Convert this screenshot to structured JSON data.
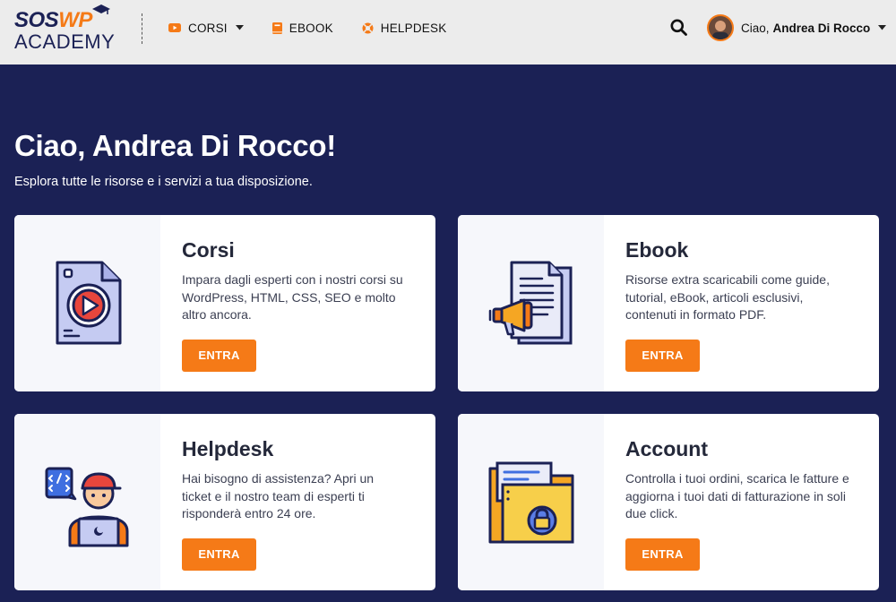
{
  "logo": {
    "line1_a": "SOS",
    "line1_b": "WP",
    "line2": "ACADEMY"
  },
  "nav": {
    "items": [
      {
        "label": "CORSI",
        "icon": "youtube-icon",
        "has_dropdown": true
      },
      {
        "label": "EBOOK",
        "icon": "book-icon",
        "has_dropdown": false
      },
      {
        "label": "HELPDESK",
        "icon": "lifebuoy-icon",
        "has_dropdown": false
      }
    ]
  },
  "user": {
    "greeting": "Ciao,",
    "name": "Andrea Di Rocco"
  },
  "hero": {
    "title": "Ciao, Andrea Di Rocco!",
    "subtitle": "Esplora tutte le risorse e i servizi a tua disposizione."
  },
  "cards": [
    {
      "title": "Corsi",
      "text": "Impara dagli esperti con i nostri corsi su WordPress, HTML, CSS, SEO e molto altro ancora.",
      "button": "ENTRA",
      "icon": "video-file-icon"
    },
    {
      "title": "Ebook",
      "text": "Risorse extra scaricabili come guide, tutorial, eBook, articoli esclusivi, contenuti in formato PDF.",
      "button": "ENTRA",
      "icon": "document-megaphone-icon"
    },
    {
      "title": "Helpdesk",
      "text": "Hai bisogno di assistenza? Apri un ticket e il nostro team di esperti ti risponderà entro 24 ore.",
      "button": "ENTRA",
      "icon": "support-agent-icon"
    },
    {
      "title": "Account",
      "text": "Controlla i tuoi ordini, scarica le fatture e aggiorna i tuoi dati di fatturazione in soli due click.",
      "button": "ENTRA",
      "icon": "locked-folder-icon"
    }
  ],
  "colors": {
    "accent": "#f57a17",
    "navy": "#1b2155",
    "header_bg": "#ececec"
  }
}
